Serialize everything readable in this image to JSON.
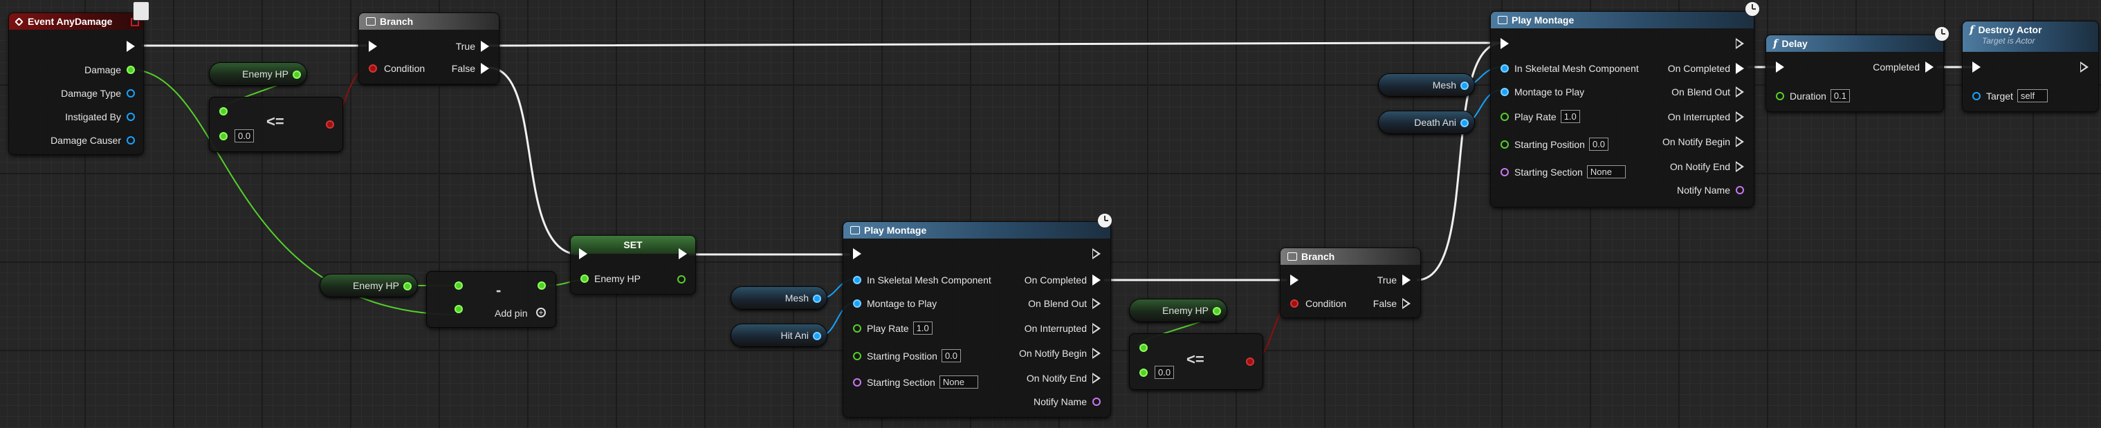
{
  "nodes": {
    "event_any_damage": {
      "title": "Event AnyDamage",
      "pins": [
        "Damage",
        "Damage Type",
        "Instigated By",
        "Damage Causer"
      ]
    },
    "enemy_hp_get_1": {
      "label": "Enemy HP"
    },
    "compare_1": {
      "operator": "<=",
      "value": "0.0"
    },
    "branch_1": {
      "title": "Branch",
      "condition": "Condition",
      "true_label": "True",
      "false_label": "False"
    },
    "enemy_hp_get_2": {
      "label": "Enemy HP"
    },
    "subtract": {
      "operator": "-",
      "add_pin": "Add pin"
    },
    "set": {
      "title": "SET",
      "pin_label": "Enemy HP"
    },
    "mesh_1": {
      "label": "Mesh"
    },
    "hit_ani": {
      "label": "Hit Ani"
    },
    "play_montage_1": {
      "title": "Play Montage",
      "in_skeletal_mesh": "In Skeletal Mesh Component",
      "montage_to_play": "Montage to Play",
      "play_rate": "Play Rate",
      "play_rate_value": "1.0",
      "starting_position": "Starting Position",
      "starting_position_value": "0.0",
      "starting_section": "Starting Section",
      "starting_section_value": "None",
      "on_completed": "On Completed",
      "on_blend_out": "On Blend Out",
      "on_interrupted": "On Interrupted",
      "on_notify_begin": "On Notify Begin",
      "on_notify_end": "On Notify End",
      "notify_name": "Notify Name"
    },
    "enemy_hp_get_3": {
      "label": "Enemy HP"
    },
    "compare_2": {
      "operator": "<=",
      "value": "0.0"
    },
    "branch_2": {
      "title": "Branch",
      "condition": "Condition",
      "true_label": "True",
      "false_label": "False"
    },
    "mesh_2": {
      "label": "Mesh"
    },
    "death_ani": {
      "label": "Death Ani"
    },
    "play_montage_2": {
      "title": "Play Montage",
      "in_skeletal_mesh": "In Skeletal Mesh Component",
      "montage_to_play": "Montage to Play",
      "play_rate": "Play Rate",
      "play_rate_value": "1.0",
      "starting_position": "Starting Position",
      "starting_position_value": "0.0",
      "starting_section": "Starting Section",
      "starting_section_value": "None",
      "on_completed": "On Completed",
      "on_blend_out": "On Blend Out",
      "on_interrupted": "On Interrupted",
      "on_notify_begin": "On Notify Begin",
      "on_notify_end": "On Notify End",
      "notify_name": "Notify Name"
    },
    "delay": {
      "title": "Delay",
      "completed": "Completed",
      "duration": "Duration",
      "duration_value": "0.1"
    },
    "destroy_actor": {
      "title": "Destroy Actor",
      "subtitle": "Target is Actor",
      "target": "Target",
      "target_value": "self"
    }
  },
  "pin_colors": {
    "exec": "#ffffff",
    "float": "#55d02a",
    "object": "#16a4ff",
    "bool": "#a30f0f",
    "name": "#c879f0"
  }
}
